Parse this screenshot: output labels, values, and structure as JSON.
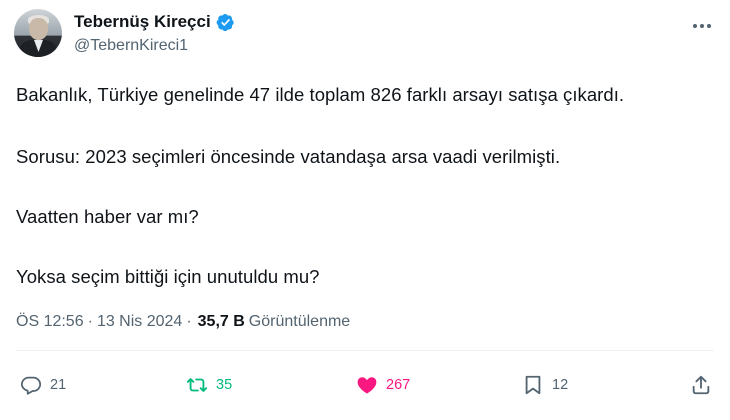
{
  "author": {
    "display_name": "Tebernüş Kireçci",
    "handle": "@TebernKireci1",
    "verified_color": "#1d9bf0"
  },
  "tweet": {
    "paragraphs": [
      "Bakanlık, Türkiye genelinde 47 ilde toplam 826 farklı arsayı satışa çıkardı.",
      "Sorusu: 2023 seçimleri öncesinde vatandaşa arsa vaadi verilmişti.",
      "Vaatten haber var mı?",
      "Yoksa seçim bittiği için unutuldu mu?"
    ],
    "time": "ÖS 12:56",
    "separator": "·",
    "date": "13 Nis 2024",
    "views_count": "35,7 B",
    "views_label": "Görüntülenme"
  },
  "actions": {
    "replies": "21",
    "retweets": "35",
    "likes": "267",
    "bookmarks": "12",
    "reply_icon": "reply-icon",
    "retweet_icon": "retweet-icon",
    "like_icon": "heart-icon",
    "bookmark_icon": "bookmark-icon",
    "share_icon": "share-icon",
    "retweet_color": "#00ba7c",
    "like_color": "#f91880",
    "muted_color": "#536471"
  }
}
